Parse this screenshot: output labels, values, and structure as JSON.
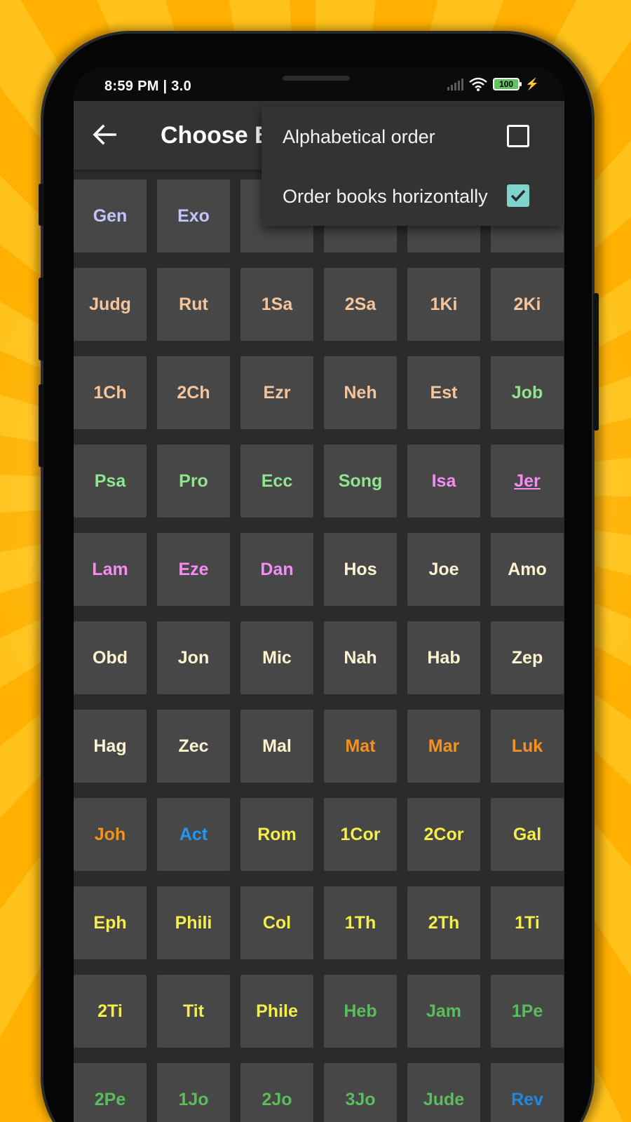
{
  "status_bar": {
    "time": "8:59 PM | 3.0",
    "battery": "100",
    "wifi_icon": "wifi-icon",
    "signal_icon": "signal-icon",
    "charging_icon": "bolt-icon"
  },
  "app_bar": {
    "title": "Choose Book",
    "back_icon": "arrow-left-icon"
  },
  "menu": {
    "items": [
      {
        "label": "Alphabetical order",
        "checked": false
      },
      {
        "label": "Order books horizontally",
        "checked": true
      }
    ]
  },
  "colors": {
    "law": "#c3c3ff",
    "history": "#f4c59c",
    "poetry": "#8ee58e",
    "major_prophets": "#f48cf4",
    "minor_prophets": "#fdf3d0",
    "gospels": "#f5921e",
    "acts": "#2196f3",
    "epistles": "#f5ee4a",
    "general_epistles": "#5cbc5c",
    "revelation": "#1e88e5",
    "checkbox_accent": "#7fd3cc"
  },
  "books": [
    {
      "name": "Gen",
      "group": "law"
    },
    {
      "name": "Exo",
      "group": "law"
    },
    {
      "name": "",
      "group": "law"
    },
    {
      "name": "",
      "group": "law"
    },
    {
      "name": "",
      "group": "history"
    },
    {
      "name": "",
      "group": "history"
    },
    {
      "name": "Judg",
      "group": "history"
    },
    {
      "name": "Rut",
      "group": "history"
    },
    {
      "name": "1Sa",
      "group": "history"
    },
    {
      "name": "2Sa",
      "group": "history"
    },
    {
      "name": "1Ki",
      "group": "history"
    },
    {
      "name": "2Ki",
      "group": "history"
    },
    {
      "name": "1Ch",
      "group": "history"
    },
    {
      "name": "2Ch",
      "group": "history"
    },
    {
      "name": "Ezr",
      "group": "history"
    },
    {
      "name": "Neh",
      "group": "history"
    },
    {
      "name": "Est",
      "group": "history"
    },
    {
      "name": "Job",
      "group": "poetry"
    },
    {
      "name": "Psa",
      "group": "poetry"
    },
    {
      "name": "Pro",
      "group": "poetry"
    },
    {
      "name": "Ecc",
      "group": "poetry"
    },
    {
      "name": "Song",
      "group": "poetry"
    },
    {
      "name": "Isa",
      "group": "major_prophets"
    },
    {
      "name": "Jer",
      "group": "major_prophets",
      "underline": true
    },
    {
      "name": "Lam",
      "group": "major_prophets"
    },
    {
      "name": "Eze",
      "group": "major_prophets"
    },
    {
      "name": "Dan",
      "group": "major_prophets"
    },
    {
      "name": "Hos",
      "group": "minor_prophets"
    },
    {
      "name": "Joe",
      "group": "minor_prophets"
    },
    {
      "name": "Amo",
      "group": "minor_prophets"
    },
    {
      "name": "Obd",
      "group": "minor_prophets"
    },
    {
      "name": "Jon",
      "group": "minor_prophets"
    },
    {
      "name": "Mic",
      "group": "minor_prophets"
    },
    {
      "name": "Nah",
      "group": "minor_prophets"
    },
    {
      "name": "Hab",
      "group": "minor_prophets"
    },
    {
      "name": "Zep",
      "group": "minor_prophets"
    },
    {
      "name": "Hag",
      "group": "minor_prophets"
    },
    {
      "name": "Zec",
      "group": "minor_prophets"
    },
    {
      "name": "Mal",
      "group": "minor_prophets"
    },
    {
      "name": "Mat",
      "group": "gospels"
    },
    {
      "name": "Mar",
      "group": "gospels"
    },
    {
      "name": "Luk",
      "group": "gospels"
    },
    {
      "name": "Joh",
      "group": "gospels"
    },
    {
      "name": "Act",
      "group": "acts"
    },
    {
      "name": "Rom",
      "group": "epistles"
    },
    {
      "name": "1Cor",
      "group": "epistles"
    },
    {
      "name": "2Cor",
      "group": "epistles"
    },
    {
      "name": "Gal",
      "group": "epistles"
    },
    {
      "name": "Eph",
      "group": "epistles"
    },
    {
      "name": "Phili",
      "group": "epistles"
    },
    {
      "name": "Col",
      "group": "epistles"
    },
    {
      "name": "1Th",
      "group": "epistles"
    },
    {
      "name": "2Th",
      "group": "epistles"
    },
    {
      "name": "1Ti",
      "group": "epistles"
    },
    {
      "name": "2Ti",
      "group": "epistles"
    },
    {
      "name": "Tit",
      "group": "epistles"
    },
    {
      "name": "Phile",
      "group": "epistles"
    },
    {
      "name": "Heb",
      "group": "general_epistles"
    },
    {
      "name": "Jam",
      "group": "general_epistles"
    },
    {
      "name": "1Pe",
      "group": "general_epistles"
    },
    {
      "name": "2Pe",
      "group": "general_epistles"
    },
    {
      "name": "1Jo",
      "group": "general_epistles"
    },
    {
      "name": "2Jo",
      "group": "general_epistles"
    },
    {
      "name": "3Jo",
      "group": "general_epistles"
    },
    {
      "name": "Jude",
      "group": "general_epistles"
    },
    {
      "name": "Rev",
      "group": "revelation"
    }
  ]
}
